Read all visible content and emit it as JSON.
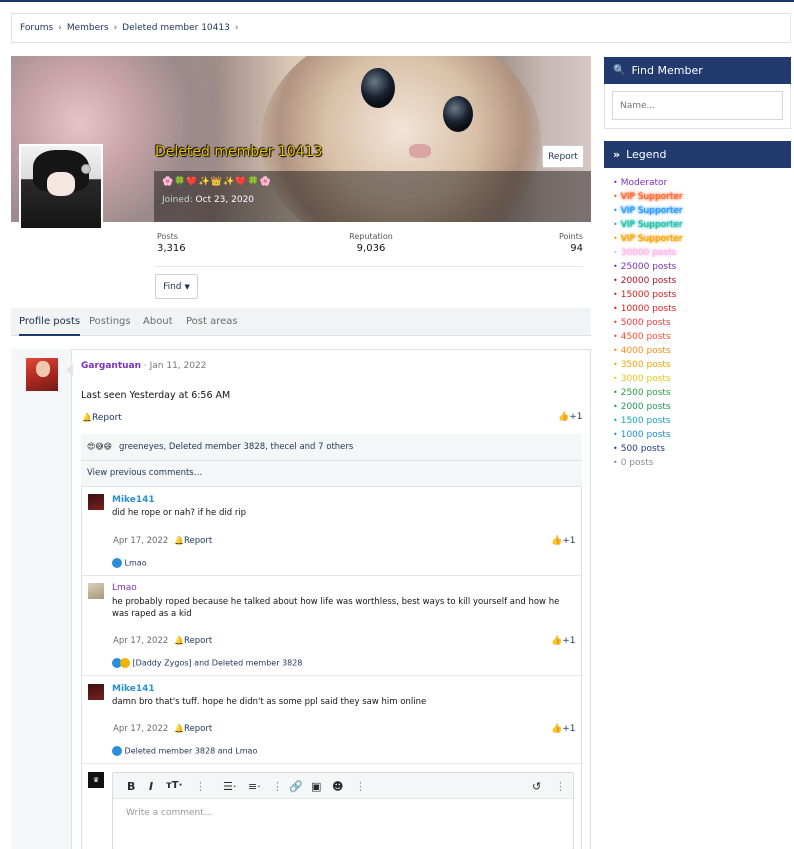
{
  "breadcrumb": {
    "items": [
      "Forums",
      "Members",
      "Deleted member 10413"
    ]
  },
  "profile": {
    "name": "Deleted member 10413",
    "emojis": "🌸🍀❤️✨👑✨❤️🍀🌸",
    "joined_label": "Joined:",
    "joined_date": "Oct 23, 2020",
    "report_label": "Report",
    "stats": [
      {
        "label": "Posts",
        "value": "3,316"
      },
      {
        "label": "Reputation",
        "value": "9,036"
      },
      {
        "label": "Points",
        "value": "94"
      }
    ],
    "find_label": "Find"
  },
  "tabs": [
    "Profile posts",
    "Postings",
    "About",
    "Post areas"
  ],
  "post": {
    "author": "Gargantuan",
    "date": "· Jan 11, 2022",
    "body": "Last seen Yesterday at 6:56 AM",
    "report_label": "Report",
    "like_count": "+1",
    "reactions_summary": "greeneyes, Deleted member 3828, thecel and 7 others",
    "view_previous": "View previous comments…"
  },
  "comments": [
    {
      "author": "Mike141",
      "text": "did he rope or nah? if he did rip",
      "date": "Apr 17, 2022",
      "report_label": "Report",
      "like_count": "+1",
      "reactions": "Lmao"
    },
    {
      "author": "Lmao",
      "text": "he probably roped because he talked about how life was worthless, best ways to kill yourself and how he was raped as a kid",
      "date": "Apr 17, 2022",
      "report_label": "Report",
      "like_count": "+1",
      "reactions": "[Daddy Zygos] and Deleted member 3828"
    },
    {
      "author": "Mike141",
      "text": "damn bro that's tuff. hope he didn't as some ppl said they saw him online",
      "date": "Apr 17, 2022",
      "report_label": "Report",
      "like_count": "+1",
      "reactions": "Deleted member 3828 and Lmao"
    }
  ],
  "editor": {
    "placeholder": "Write a comment..."
  },
  "sidebar": {
    "find_member_title": "Find Member",
    "search_placeholder": "Name...",
    "legend_title": "Legend",
    "legend": [
      {
        "label": "Moderator",
        "color": "#7b2fbf"
      },
      {
        "label": "VIP Supporter",
        "color": "#ff5a1f"
      },
      {
        "label": "VIP Supporter",
        "color": "#1e90ff"
      },
      {
        "label": "VIP Supporter",
        "color": "#14b8a6"
      },
      {
        "label": "VIP Supporter",
        "color": "#f0a000"
      },
      {
        "label": "30000 posts",
        "color": "#ffb3e6"
      },
      {
        "label": "25000 posts",
        "color": "#7b2fbf"
      },
      {
        "label": "20000 posts",
        "color": "#b0122a"
      },
      {
        "label": "15000 posts",
        "color": "#d11f1f"
      },
      {
        "label": "10000 posts",
        "color": "#e02020"
      },
      {
        "label": "5000 posts",
        "color": "#ea3a3a"
      },
      {
        "label": "4500 posts",
        "color": "#ff4d2e"
      },
      {
        "label": "4000 posts",
        "color": "#ff8c1a"
      },
      {
        "label": "3500 posts",
        "color": "#f0a500"
      },
      {
        "label": "3000 posts",
        "color": "#e6c619"
      },
      {
        "label": "2500 posts",
        "color": "#2aa040"
      },
      {
        "label": "2000 posts",
        "color": "#1f9a55"
      },
      {
        "label": "1500 posts",
        "color": "#14a7b8"
      },
      {
        "label": "1000 posts",
        "color": "#1a8fd6"
      },
      {
        "label": "500 posts",
        "color": "#1b3a8a"
      },
      {
        "label": "0 posts",
        "color": "#8c8c8c"
      }
    ]
  },
  "colors": {
    "header_bg": "#233a6e",
    "link": "#1c3557"
  }
}
